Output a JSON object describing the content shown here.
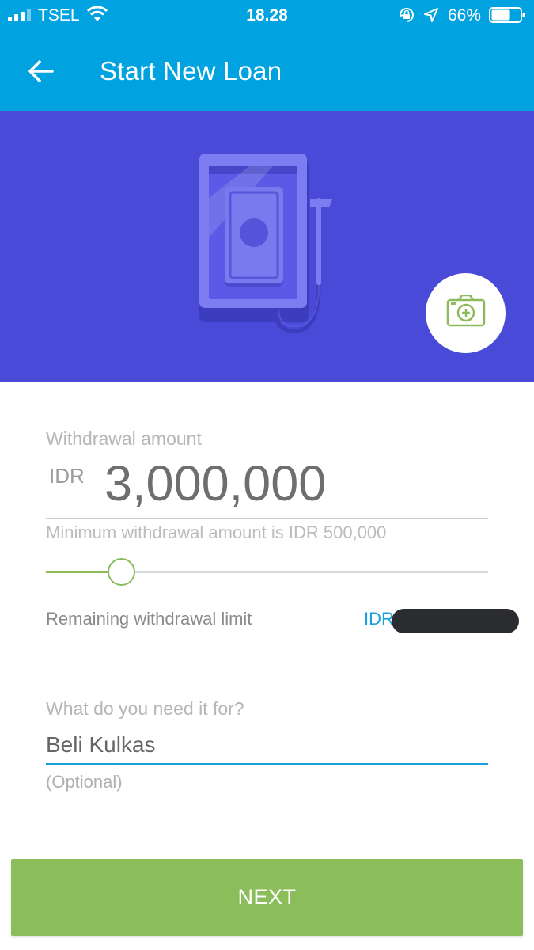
{
  "status_bar": {
    "carrier": "TSEL",
    "time": "18.28",
    "battery_percent": "66%",
    "battery_level": 0.66
  },
  "app_bar": {
    "title": "Start New Loan",
    "back_icon": "arrow-left-icon"
  },
  "hero": {
    "illustration": "atm-cash-machine-illustration",
    "camera_button_icon": "camera-add-icon"
  },
  "form": {
    "amount_label": "Withdrawal amount",
    "currency": "IDR",
    "amount_value": "3,000,000",
    "min_hint": "Minimum withdrawal amount is IDR 500,000",
    "slider_fraction": 0.17,
    "remaining_limit_label": "Remaining withdrawal limit",
    "remaining_limit_currency": "IDR",
    "purpose_label": "What do you need it for?",
    "purpose_value": "Beli Kulkas",
    "optional_hint": "(Optional)"
  },
  "actions": {
    "next_label": "NEXT"
  },
  "colors": {
    "app_bar": "#00a3e0",
    "hero_background": "#4a4ad8",
    "accent_green": "#8cbd5b",
    "accent_blue": "#1aa0db"
  }
}
